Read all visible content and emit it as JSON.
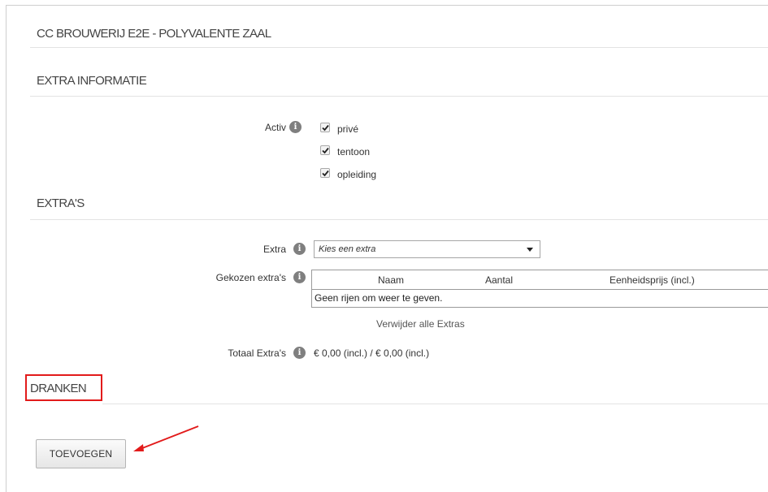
{
  "header": {
    "title": "CC BROUWERIJ E2E  - POLYVALENTE ZAAL"
  },
  "extra_informatie": {
    "title": "EXTRA INFORMATIE",
    "activ_label": "Activ",
    "options": [
      {
        "label": "privé",
        "checked": true
      },
      {
        "label": "tentoon",
        "checked": true
      },
      {
        "label": "opleiding",
        "checked": true
      }
    ]
  },
  "extras": {
    "title": "EXTRA'S",
    "extra_label": "Extra",
    "extra_select_value": "Kies een extra",
    "gekozen_label": "Gekozen extra's",
    "columns": [
      "Naam",
      "Aantal",
      "Eenheidsprijs (incl.)"
    ],
    "empty_text": "Geen rijen om weer te geven.",
    "remove_all_link": "Verwijder alle Extras",
    "totaal_label": "Totaal Extra's",
    "totaal_value": "€ 0,00 (incl.) / € 0,00 (incl.)"
  },
  "dranken": {
    "title": "DRANKEN",
    "add_button": "TOEVOEGEN",
    "highlight_color": "#e21b1b"
  }
}
